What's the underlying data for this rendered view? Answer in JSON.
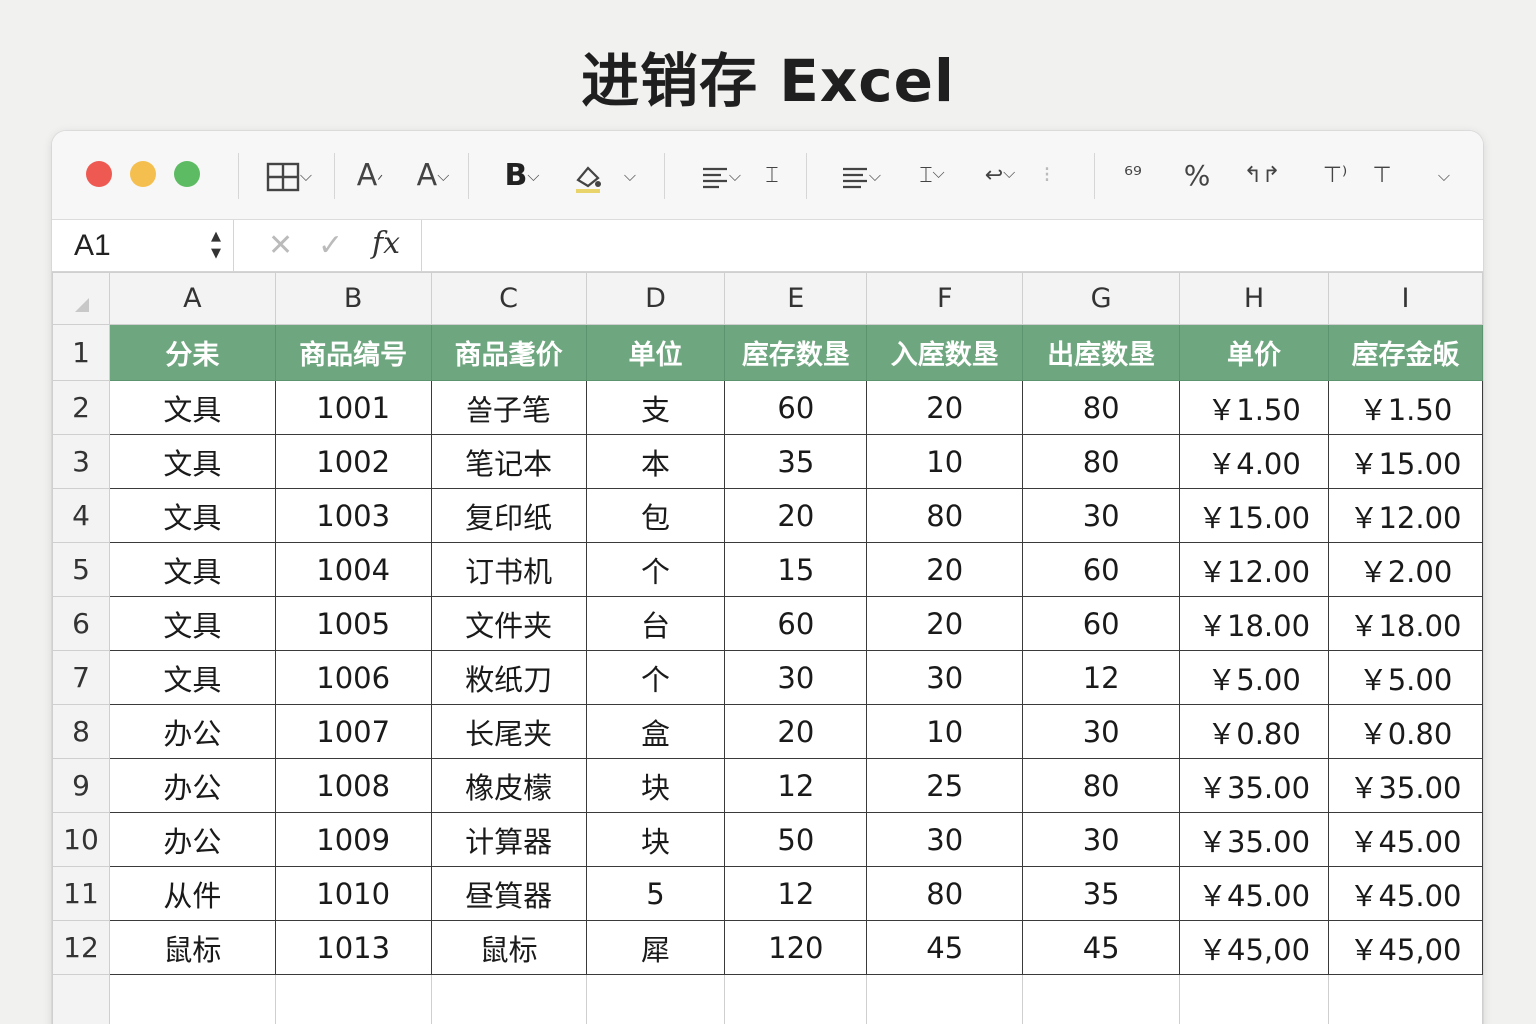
{
  "page": {
    "title": "进销存 Excel"
  },
  "toolbar": {
    "font_size_up": "A",
    "font_size_down": "A",
    "bold": "B",
    "percent": "%"
  },
  "formula_bar": {
    "cell_ref": "A1",
    "stepper": "▲▼",
    "fx_label": "fx",
    "formula": ""
  },
  "grid": {
    "columns": [
      "A",
      "B",
      "C",
      "D",
      "E",
      "F",
      "G",
      "H",
      "I"
    ],
    "row_numbers": [
      "1",
      "2",
      "3",
      "4",
      "5",
      "6",
      "7",
      "8",
      "9",
      "10",
      "11",
      "12"
    ],
    "header_row": [
      "分耒",
      "商品缟号",
      "商品耄价",
      "单位",
      "庢存数垦",
      "入庢数垦",
      "出庢数垦",
      "单价",
      "庢存金皈"
    ],
    "rows": [
      [
        "文具",
        "1001",
        "쏠子笔",
        "支",
        "60",
        "20",
        "80",
        "￥1.50",
        "￥1.50"
      ],
      [
        "文具",
        "1002",
        "笔记本",
        "本",
        "35",
        "10",
        "80",
        "￥4.00",
        "￥15.00"
      ],
      [
        "文具",
        "1003",
        "复印纸",
        "包",
        "20",
        "80",
        "30",
        "￥15.00",
        "￥12.00"
      ],
      [
        "文具",
        "1004",
        "订书机",
        "个",
        "15",
        "20",
        "60",
        "￥12.00",
        "￥2.00"
      ],
      [
        "文具",
        "1005",
        "文件夹",
        "台",
        "60",
        "20",
        "60",
        "￥18.00",
        "￥18.00"
      ],
      [
        "文具",
        "1006",
        "敉纸刀",
        "个",
        "30",
        "30",
        "12",
        "￥5.00",
        "￥5.00"
      ],
      [
        "办公",
        "1007",
        "长尾夹",
        "盒",
        "20",
        "10",
        "30",
        "￥0.80",
        "￥0.80"
      ],
      [
        "办公",
        "1008",
        "橡皮檬",
        "块",
        "12",
        "25",
        "80",
        "￥35.00",
        "￥35.00"
      ],
      [
        "办公",
        "1009",
        "计算器",
        "块",
        "50",
        "30",
        "30",
        "￥35.00",
        "￥45.00"
      ],
      [
        "从件",
        "1010",
        "昼筫器",
        "5",
        "12",
        "80",
        "35",
        "￥45.00",
        "￥45.00"
      ],
      [
        "鼠标",
        "1013",
        "鼠标",
        "犀",
        "120",
        "45",
        "45",
        "￥45,00",
        "￥45,00"
      ]
    ]
  }
}
